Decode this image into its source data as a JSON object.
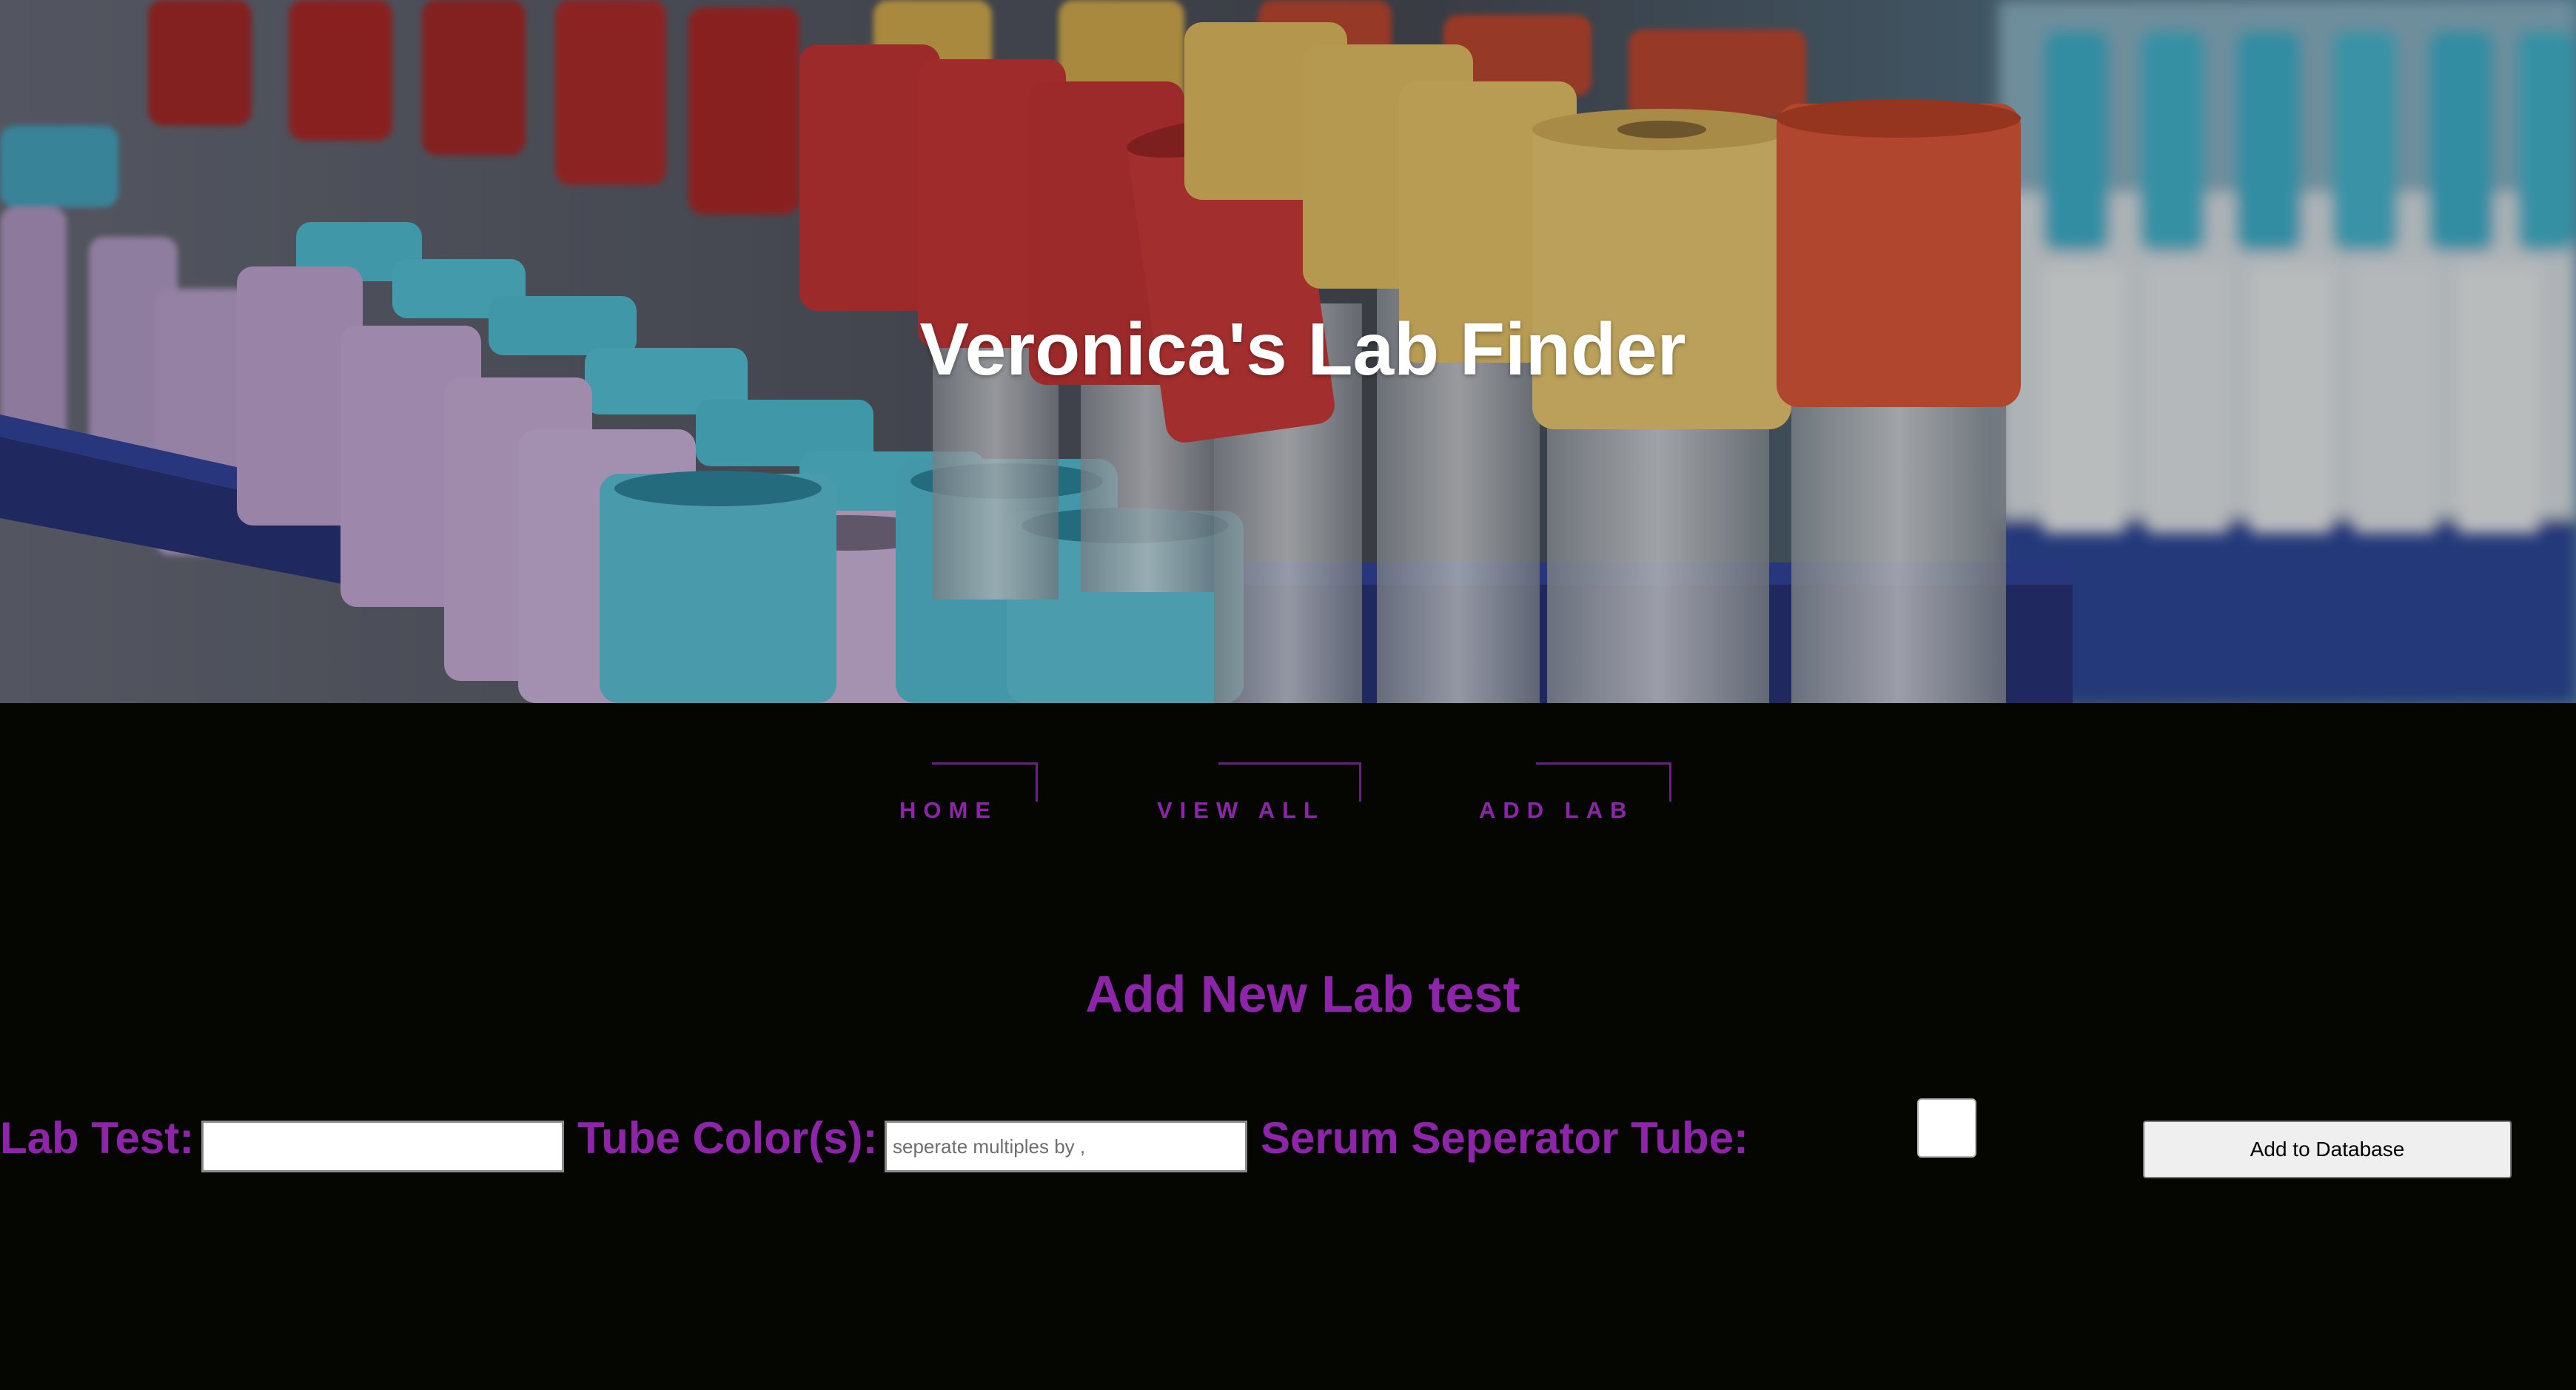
{
  "header": {
    "title": "Veronica's Lab Finder",
    "background_image": "laboratory-test-tubes-with-colored-caps"
  },
  "nav": {
    "items": [
      {
        "label": "HOME"
      },
      {
        "label": "VIEW ALL"
      },
      {
        "label": "ADD LAB"
      }
    ]
  },
  "form": {
    "title": "Add New Lab test",
    "lab_test_label": "Lab Test:",
    "lab_test_value": "",
    "tube_color_label": "Tube Color(s):",
    "tube_color_placeholder": "seperate multiples by ,",
    "serum_label": "Serum Seperator Tube:",
    "serum_checked": false,
    "submit_label": "Add to Database"
  },
  "colors": {
    "page_background": "#050602",
    "accent": "#8e24aa",
    "title_text": "#ffffff"
  }
}
